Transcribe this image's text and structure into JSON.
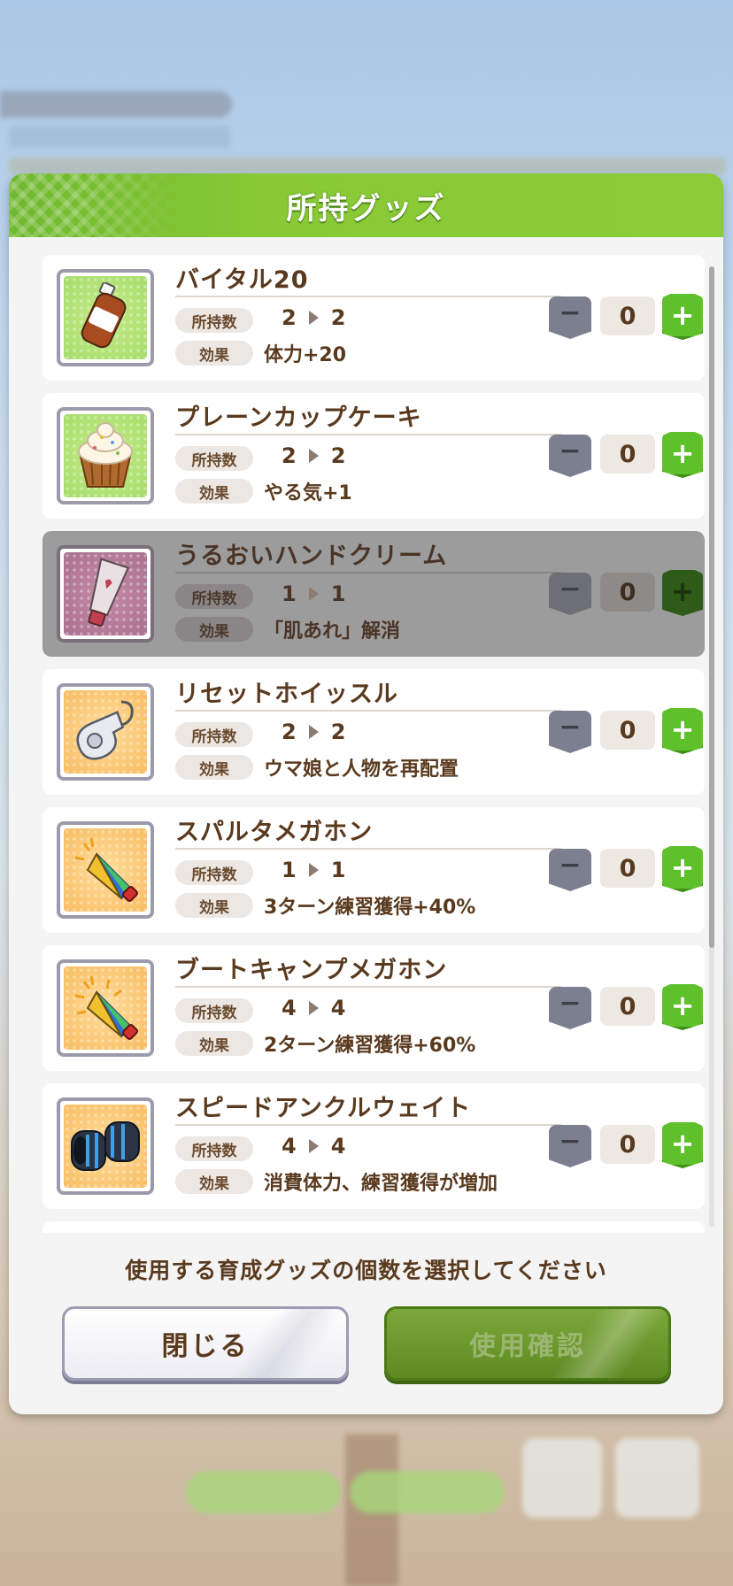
{
  "dialog": {
    "title": "所持グッズ",
    "instruction": "使用する育成グッズの個数を選択してください",
    "close_label": "閉じる",
    "confirm_label": "使用確認"
  },
  "labels": {
    "owned": "所持数",
    "effect": "効果"
  },
  "items": [
    {
      "name": "バイタル20",
      "owned_before": "2",
      "owned_after": "2",
      "effect": "体力+20",
      "count": "0",
      "icon": "bottle-icon",
      "disabled": false
    },
    {
      "name": "プレーンカップケーキ",
      "owned_before": "2",
      "owned_after": "2",
      "effect": "やる気+1",
      "count": "0",
      "icon": "cupcake-icon",
      "disabled": false
    },
    {
      "name": "うるおいハンドクリーム",
      "owned_before": "1",
      "owned_after": "1",
      "effect": "「肌あれ」解消",
      "count": "0",
      "icon": "hand-cream-icon",
      "disabled": true
    },
    {
      "name": "リセットホイッスル",
      "owned_before": "2",
      "owned_after": "2",
      "effect": "ウマ娘と人物を再配置",
      "count": "0",
      "icon": "whistle-icon",
      "disabled": false
    },
    {
      "name": "スパルタメガホン",
      "owned_before": "1",
      "owned_after": "1",
      "effect": "3ターン練習獲得+40%",
      "count": "0",
      "icon": "megaphone-icon",
      "disabled": false
    },
    {
      "name": "ブートキャンプメガホン",
      "owned_before": "4",
      "owned_after": "4",
      "effect": "2ターン練習獲得+60%",
      "count": "0",
      "icon": "megaphone-icon",
      "disabled": false
    },
    {
      "name": "スピードアンクルウェイト",
      "owned_before": "4",
      "owned_after": "4",
      "effect": "消費体力、練習獲得が増加",
      "count": "0",
      "icon": "ankle-weight-icon",
      "disabled": false
    }
  ],
  "colors": {
    "header_green": "#88c935",
    "text_brown": "#5a3a1e",
    "plus_green": "#5ec12b"
  }
}
